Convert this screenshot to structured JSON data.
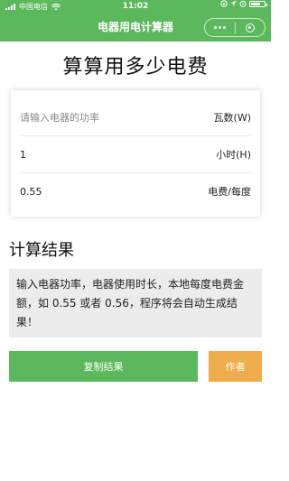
{
  "status_bar": {
    "carrier": "中国电信",
    "time": "11:02"
  },
  "nav": {
    "title": "电器用电计算器"
  },
  "page": {
    "heading": "算算用多少电费"
  },
  "form": {
    "power": {
      "placeholder": "请输入电器的功率",
      "value": "",
      "unit": "瓦数(W)"
    },
    "hours": {
      "value": "1",
      "unit": "小时(H)"
    },
    "price": {
      "value": "0.55",
      "unit": "电费/每度"
    }
  },
  "result": {
    "title": "计算结果",
    "text": "输入电器功率，电器使用时长，本地每度电费金额，如 0.55 或者 0.56，程序将会自动生成结果！"
  },
  "buttons": {
    "copy": "复制结果",
    "author": "作者"
  },
  "colors": {
    "primary": "#5cb85c",
    "accent": "#f0ad4e",
    "result_bg": "#ececec"
  }
}
